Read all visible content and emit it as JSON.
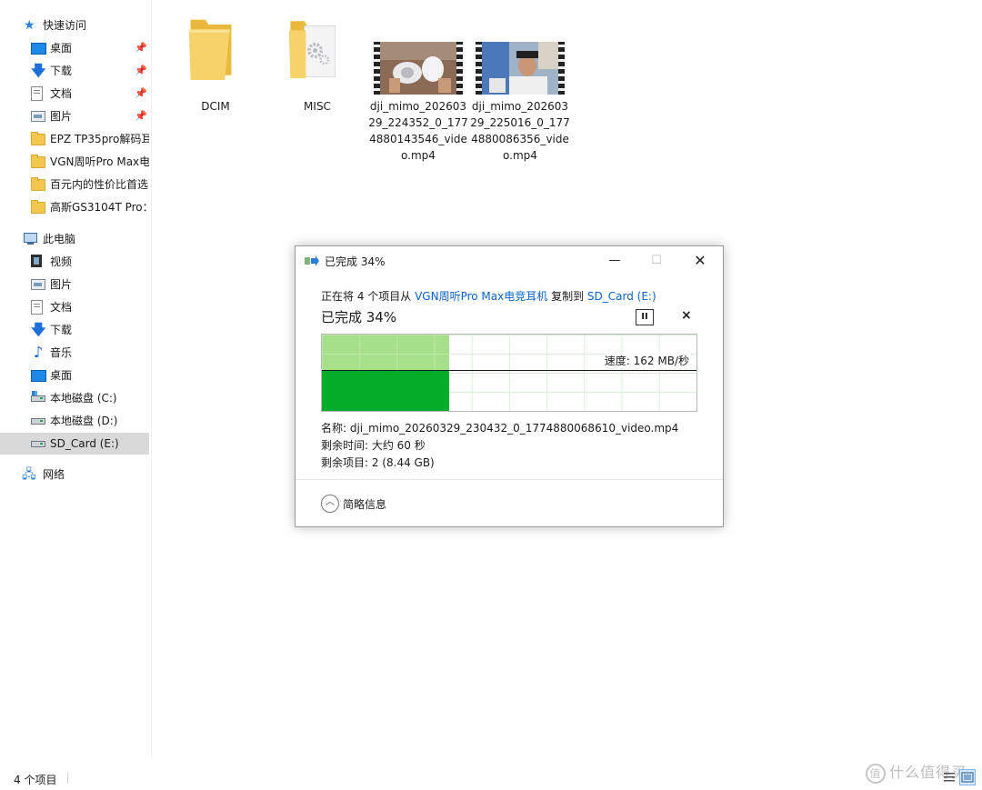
{
  "sidebar": {
    "quick_access_label": "快速访问",
    "quick_access_items": [
      {
        "label": "桌面",
        "icon": "desktop-icon"
      },
      {
        "label": "下载",
        "icon": "download-icon"
      },
      {
        "label": "文档",
        "icon": "document-icon"
      },
      {
        "label": "图片",
        "icon": "picture-icon"
      },
      {
        "label": "EPZ TP35pro解码耳",
        "icon": "folder-icon"
      },
      {
        "label": "VGN周听Pro Max电",
        "icon": "folder-icon"
      },
      {
        "label": "百元内的性价比首选",
        "icon": "folder-icon"
      },
      {
        "label": "高斯GS3104T Pro：",
        "icon": "folder-icon"
      }
    ],
    "this_pc_label": "此电脑",
    "this_pc_items": [
      {
        "label": "视频",
        "icon": "video-icon"
      },
      {
        "label": "图片",
        "icon": "picture-icon"
      },
      {
        "label": "文档",
        "icon": "document-icon"
      },
      {
        "label": "下载",
        "icon": "download-icon"
      },
      {
        "label": "音乐",
        "icon": "music-icon"
      },
      {
        "label": "桌面",
        "icon": "desktop-icon"
      },
      {
        "label": "本地磁盘 (C:)",
        "icon": "drive-c-icon"
      },
      {
        "label": "本地磁盘 (D:)",
        "icon": "drive-icon"
      },
      {
        "label": "SD_Card (E:)",
        "icon": "drive-icon",
        "selected": true
      }
    ],
    "network_label": "网络",
    "pin_glyph": "📌"
  },
  "files": [
    {
      "name": "DCIM",
      "type": "folder"
    },
    {
      "name": "MISC",
      "type": "folder-settings"
    },
    {
      "name": "dji_mimo_20260329_224352_0_1774880143546_video.mp4",
      "type": "video"
    },
    {
      "name": "dji_mimo_20260329_225016_0_1774880086356_video.mp4",
      "type": "video"
    }
  ],
  "dialog": {
    "title": "已完成 34%",
    "desc_prefix": "正在将 4 个项目从 ",
    "source": "VGN周听Pro Max电竞耳机",
    "desc_mid": " 复制到 ",
    "destination": "SD_Card (E:)",
    "percent_text": "已完成 34%",
    "progress": 0.34,
    "speed": "速度: 162 MB/秒",
    "name_line": "名称: dji_mimo_20260329_230432_0_1774880068610_video.mp4",
    "time_left": "剩余时间: 大约 60 秒",
    "items_left": "剩余项目: 2 (8.44 GB)",
    "details_toggle": "简略信息",
    "pause_glyph": "II",
    "cancel_glyph": "×",
    "min_glyph": "—",
    "max_glyph": "☐",
    "close_glyph": "✕",
    "collapse_glyph": "︿"
  },
  "statusbar": {
    "count": "4 个项目"
  },
  "watermark": {
    "mark": "值",
    "text": "什么值得买"
  }
}
